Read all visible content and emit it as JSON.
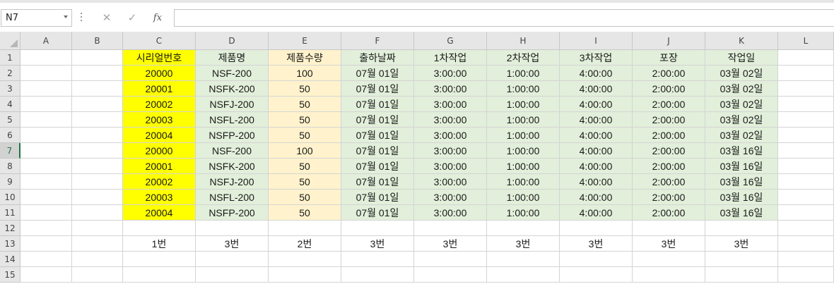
{
  "name_box": {
    "value": "N7"
  },
  "formula_bar": {
    "cancel_symbol": "✕",
    "enter_symbol": "✓",
    "fx_label": "fx",
    "value": ""
  },
  "colors": {
    "yellow": "#ffff00",
    "green": "#e2efda",
    "peach": "#fff2cc",
    "white": "#ffffff",
    "accent": "#217346"
  },
  "columns": [
    "A",
    "B",
    "C",
    "D",
    "E",
    "F",
    "G",
    "H",
    "I",
    "J",
    "K",
    "L"
  ],
  "rows": [
    "1",
    "2",
    "3",
    "4",
    "5",
    "6",
    "7",
    "8",
    "9",
    "10",
    "11",
    "12",
    "13",
    "14",
    "15"
  ],
  "selected_row": "7",
  "sheet": {
    "headers": [
      "시리얼번호",
      "제품명",
      "제품수량",
      "출하날짜",
      "1차작업",
      "2차작업",
      "3차작업",
      "포장",
      "작업일"
    ],
    "data": [
      [
        "20000",
        "NSF-200",
        "100",
        "07월 01일",
        "3:00:00",
        "1:00:00",
        "4:00:00",
        "2:00:00",
        "03월 02일"
      ],
      [
        "20001",
        "NSFK-200",
        "50",
        "07월 01일",
        "3:00:00",
        "1:00:00",
        "4:00:00",
        "2:00:00",
        "03월 02일"
      ],
      [
        "20002",
        "NSFJ-200",
        "50",
        "07월 01일",
        "3:00:00",
        "1:00:00",
        "4:00:00",
        "2:00:00",
        "03월 02일"
      ],
      [
        "20003",
        "NSFL-200",
        "50",
        "07월 01일",
        "3:00:00",
        "1:00:00",
        "4:00:00",
        "2:00:00",
        "03월 02일"
      ],
      [
        "20004",
        "NSFP-200",
        "50",
        "07월 01일",
        "3:00:00",
        "1:00:00",
        "4:00:00",
        "2:00:00",
        "03월 02일"
      ],
      [
        "20000",
        "NSF-200",
        "100",
        "07월 01일",
        "3:00:00",
        "1:00:00",
        "4:00:00",
        "2:00:00",
        "03월 16일"
      ],
      [
        "20001",
        "NSFK-200",
        "50",
        "07월 01일",
        "3:00:00",
        "1:00:00",
        "4:00:00",
        "2:00:00",
        "03월 16일"
      ],
      [
        "20002",
        "NSFJ-200",
        "50",
        "07월 01일",
        "3:00:00",
        "1:00:00",
        "4:00:00",
        "2:00:00",
        "03월 16일"
      ],
      [
        "20003",
        "NSFL-200",
        "50",
        "07월 01일",
        "3:00:00",
        "1:00:00",
        "4:00:00",
        "2:00:00",
        "03월 16일"
      ],
      [
        "20004",
        "NSFP-200",
        "50",
        "07월 01일",
        "3:00:00",
        "1:00:00",
        "4:00:00",
        "2:00:00",
        "03월 16일"
      ]
    ],
    "row13": [
      "1번",
      "3번",
      "2번",
      "3번",
      "3번",
      "3번",
      "3번",
      "3번",
      "3번"
    ]
  }
}
